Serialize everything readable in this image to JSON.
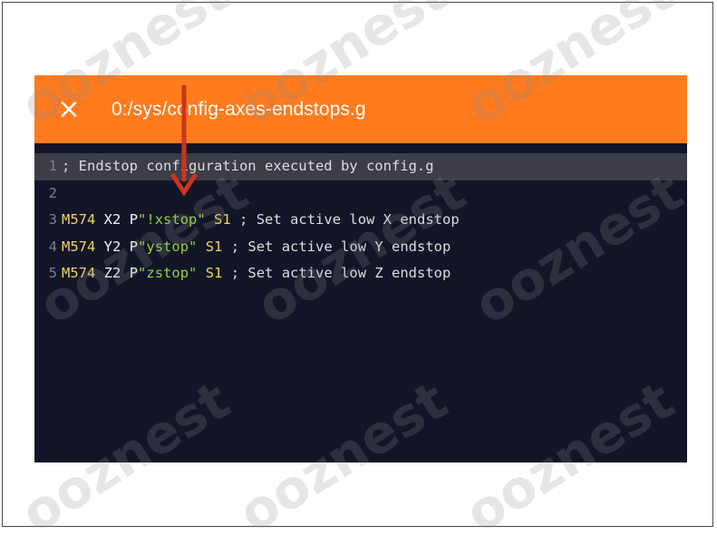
{
  "editor": {
    "close_icon": "close-icon",
    "close_glyph": "×",
    "file_path": "0:/sys/config-axes-endstops.g",
    "colors": {
      "title_bar": "#ff7b1d",
      "background": "#121527",
      "active_line": "#3c3d47",
      "gcode": "#f2d55e",
      "string": "#94d53a",
      "arrow": "#c9351f"
    },
    "lines": [
      {
        "num": "1",
        "comment": "; Endstop configuration executed by config.g"
      },
      {
        "num": "2"
      },
      {
        "num": "3",
        "cmd": "M574",
        "axis": "X2",
        "pin_prefix": "P",
        "pin": "\"!xstop\"",
        "setting": "S1",
        "comment": "; Set active low X endstop"
      },
      {
        "num": "4",
        "cmd": "M574",
        "axis": "Y2",
        "pin_prefix": "P",
        "pin": "\"ystop\"",
        "setting": "S1",
        "comment": "; Set active low Y endstop"
      },
      {
        "num": "5",
        "cmd": "M574",
        "axis": "Z2",
        "pin_prefix": "P",
        "pin": "\"zstop\"",
        "setting": "S1",
        "comment": "; Set active low Z endstop"
      }
    ]
  },
  "watermark": "ooznest"
}
